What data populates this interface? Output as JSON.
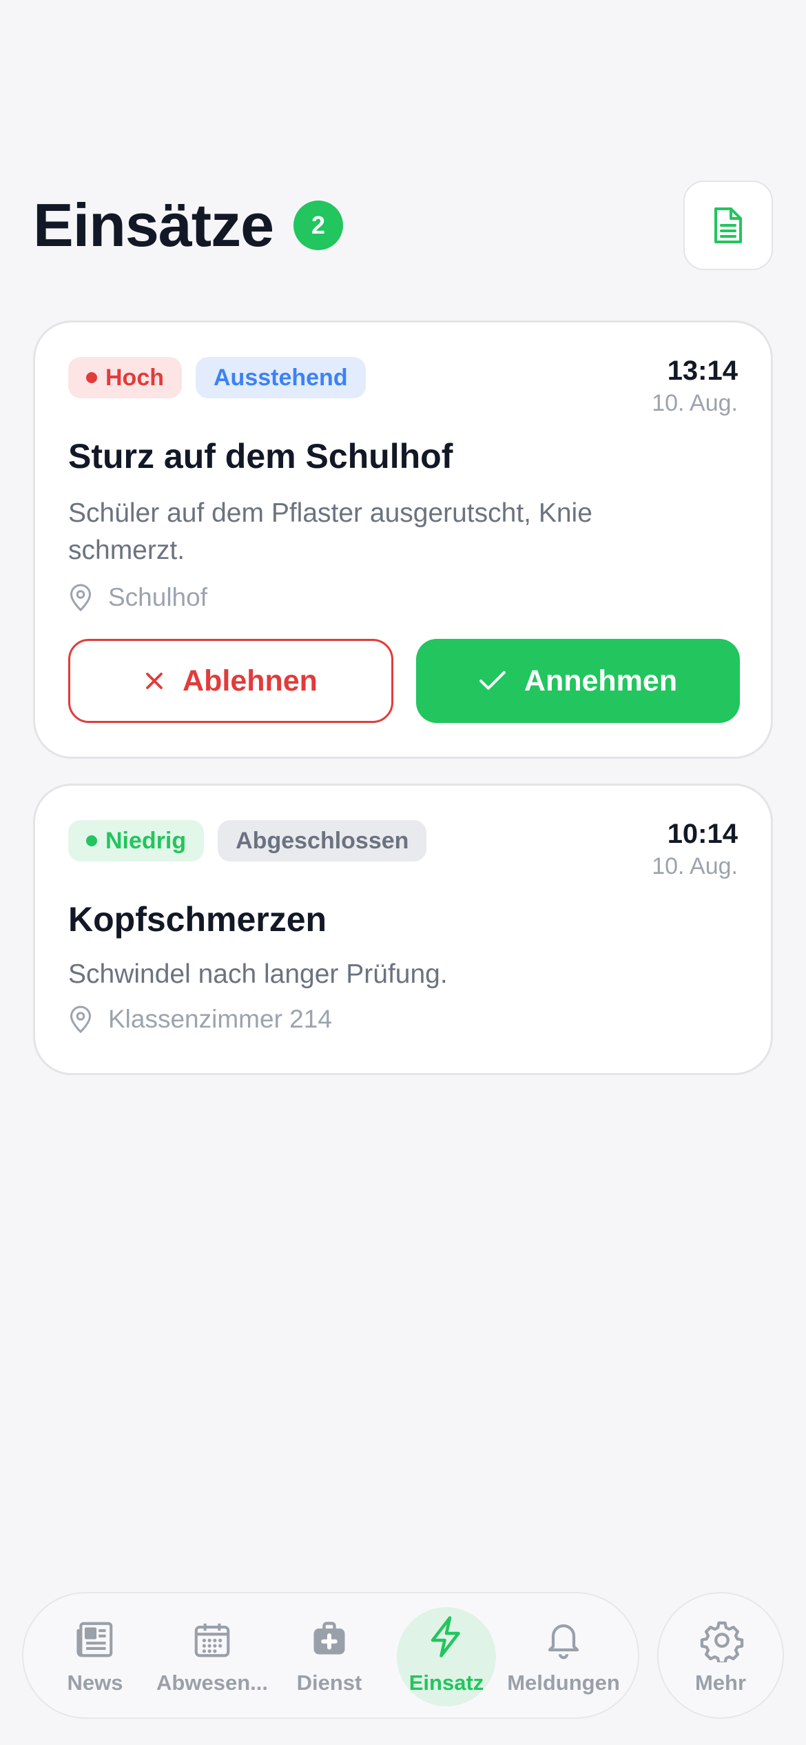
{
  "header": {
    "title": "Einsätze",
    "count": "2",
    "report_icon": "document-icon"
  },
  "incidents": [
    {
      "priority": "Hoch",
      "status": "Ausstehend",
      "time": "13:14",
      "date": "10. Aug.",
      "title": "Sturz auf dem Schulhof",
      "description": "Schüler auf dem Pflaster ausgerutscht, Knie schmerzt.",
      "location": "Schulhof",
      "decline_label": "Ablehnen",
      "accept_label": "Annehmen"
    },
    {
      "priority": "Niedrig",
      "status": "Abgeschlossen",
      "time": "10:14",
      "date": "10. Aug.",
      "title": "Kopfschmerzen",
      "description": "Schwindel nach langer Prüfung.",
      "location": "Klassenzimmer 214"
    }
  ],
  "nav": {
    "items": [
      {
        "label": "News",
        "icon": "newspaper-icon"
      },
      {
        "label": "Abwesen...",
        "icon": "calendar-icon"
      },
      {
        "label": "Dienst",
        "icon": "medical-bag-icon"
      },
      {
        "label": "Einsatz",
        "icon": "lightning-icon",
        "active": true
      },
      {
        "label": "Meldungen",
        "icon": "bell-icon"
      }
    ],
    "more": {
      "label": "Mehr",
      "icon": "gear-icon"
    }
  },
  "colors": {
    "accent": "#22c55e",
    "danger": "#e23b3b",
    "info": "#3b82f6",
    "muted": "#9aa0aa"
  }
}
